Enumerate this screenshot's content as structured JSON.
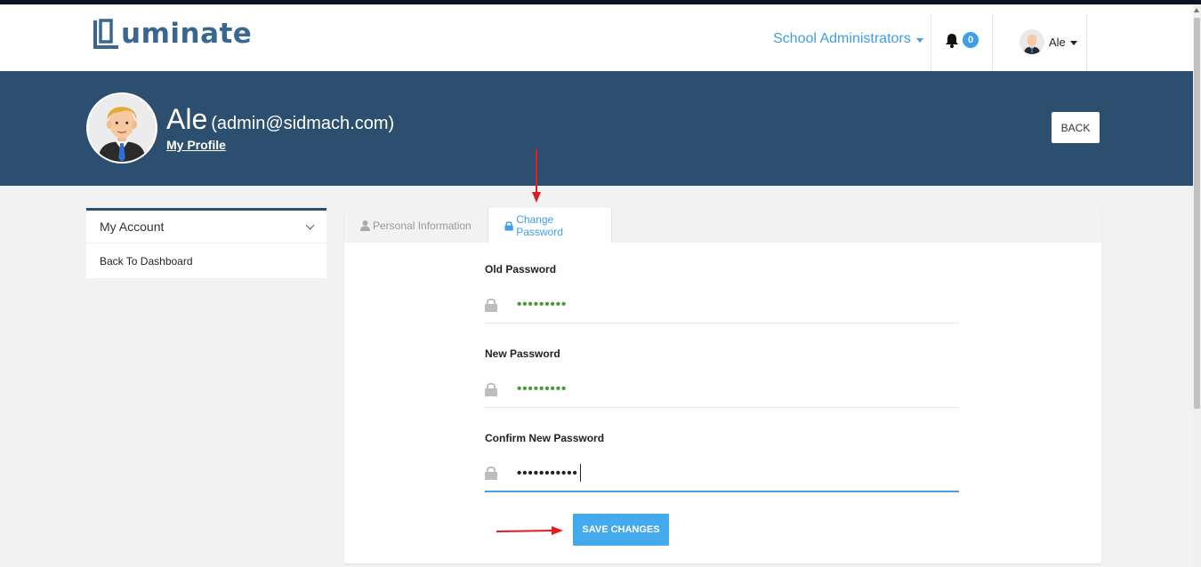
{
  "brand": {
    "logo_text": "uminate",
    "accent": "#3f9ee8",
    "banner_color": "#2d4f6f"
  },
  "navbar": {
    "role_label": "School Administrators",
    "notification_count": "0",
    "user_name": "Ale"
  },
  "profile": {
    "name": "Ale",
    "email": "(admin@sidmach.com)",
    "link_label": "My Profile",
    "back_label": "BACK"
  },
  "sidebar": {
    "header": "My Account",
    "items": [
      {
        "label": "Back To Dashboard"
      }
    ]
  },
  "tabs": [
    {
      "label": "Personal Information",
      "icon": "user-icon",
      "active": false
    },
    {
      "label": "Change Password",
      "icon": "lock-icon",
      "active": true
    }
  ],
  "form": {
    "fields": [
      {
        "label": "Old Password",
        "value": "•••••••••"
      },
      {
        "label": "New Password",
        "value": "•••••••••"
      },
      {
        "label": "Confirm New Password",
        "value": "•••••••••••"
      }
    ],
    "submit_label": "SAVE CHANGES"
  },
  "annotations": [
    {
      "icon": "red-arrow-down-icon"
    },
    {
      "icon": "red-arrow-right-icon"
    }
  ]
}
